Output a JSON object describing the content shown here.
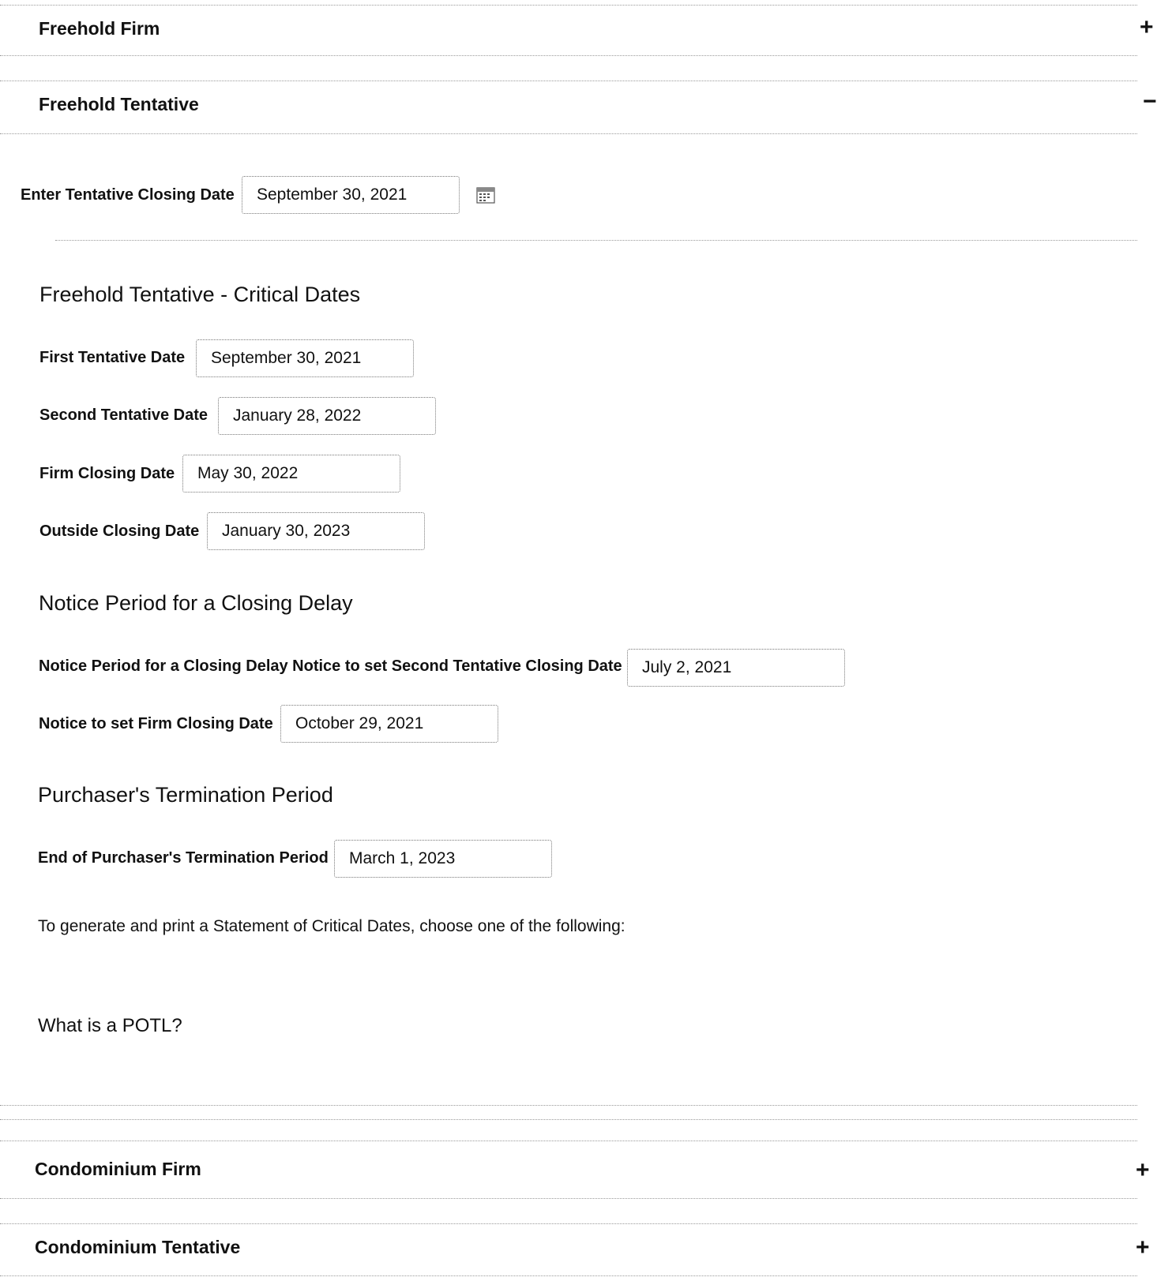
{
  "accordions": {
    "freehold_firm": {
      "title": "Freehold Firm",
      "toggle": "+"
    },
    "freehold_tentative": {
      "title": "Freehold Tentative",
      "toggle": "−"
    },
    "condominium_firm": {
      "title": "Condominium Firm",
      "toggle": "+"
    },
    "condominium_tentative": {
      "title": "Condominium Tentative",
      "toggle": "+"
    }
  },
  "tentative_closing": {
    "label": "Enter Tentative Closing Date",
    "value": "September 30, 2021",
    "icon": "calendar-icon"
  },
  "critical_dates": {
    "heading": "Freehold Tentative - Critical Dates",
    "first_label": "First Tentative Date",
    "first_value": "September 30, 2021",
    "second_label": "Second Tentative Date",
    "second_value": "January 28, 2022",
    "firm_label": "Firm Closing Date",
    "firm_value": "May 30, 2022",
    "outside_label": "Outside Closing Date",
    "outside_value": "January 30, 2023"
  },
  "notice_period": {
    "heading": "Notice Period for a Closing Delay",
    "second_notice_label": "Notice Period for a Closing Delay Notice to set Second Tentative Closing Date",
    "second_notice_value": "July 2, 2021",
    "firm_notice_label": "Notice to set Firm Closing Date",
    "firm_notice_value": "October 29, 2021"
  },
  "termination": {
    "heading": "Purchaser's Termination Period",
    "end_label": "End of Purchaser's Termination Period",
    "end_value": "March 1, 2023"
  },
  "statement_text": "To generate and print a Statement of Critical Dates, choose one of the following:",
  "potl_text": "What is a POTL?"
}
